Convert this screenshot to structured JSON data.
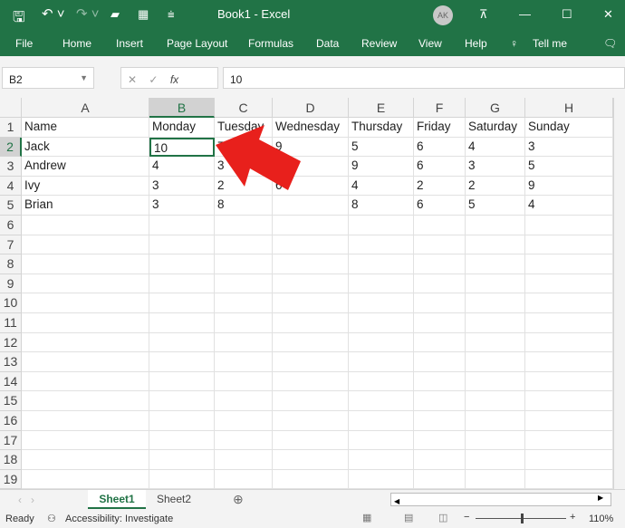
{
  "window": {
    "title": "Book1 - Excel",
    "avatar": "AK",
    "qat_icons": [
      "save-icon",
      "undo-icon",
      "redo-icon",
      "open-icon",
      "table-icon",
      "customize-icon"
    ]
  },
  "ribbon": {
    "tabs": [
      "File",
      "Home",
      "Insert",
      "Page Layout",
      "Formulas",
      "Data",
      "Review",
      "View",
      "Help"
    ],
    "tell_me": "Tell me"
  },
  "formula_bar": {
    "name_box": "B2",
    "value": "10"
  },
  "columns": [
    "A",
    "B",
    "C",
    "D",
    "E",
    "F",
    "G",
    "H"
  ],
  "rows": [
    [
      "Name",
      "Monday",
      "Tuesday",
      "Wednesday",
      "Thursday",
      "Friday",
      "Saturday",
      "Sunday"
    ],
    [
      "Jack",
      "10",
      "7",
      "9",
      "5",
      "6",
      "4",
      "3"
    ],
    [
      "Andrew",
      "4",
      "3",
      "",
      "9",
      "6",
      "3",
      "5"
    ],
    [
      "Ivy",
      "3",
      "2",
      "6",
      "4",
      "2",
      "2",
      "9"
    ],
    [
      "Brian",
      "3",
      "8",
      "",
      "8",
      "6",
      "5",
      "4"
    ]
  ],
  "row_count": 19,
  "selected_cell": "B2",
  "sheets": {
    "tabs": [
      "Sheet1",
      "Sheet2"
    ],
    "active": "Sheet1"
  },
  "status": {
    "ready": "Ready",
    "accessibility": "Accessibility: Investigate",
    "zoom": "110%"
  },
  "colors": {
    "accent": "#217346",
    "arrow": "#e8201c"
  }
}
